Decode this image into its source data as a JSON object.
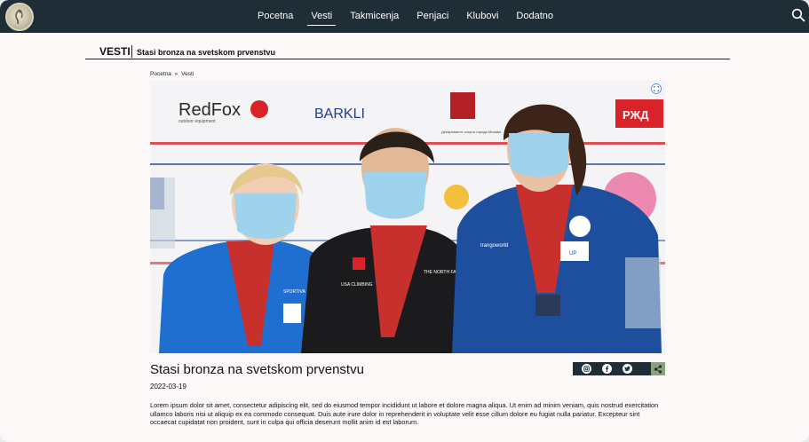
{
  "nav": {
    "items": [
      {
        "label": "Pocetna"
      },
      {
        "label": "Vesti"
      },
      {
        "label": "Takmicenja"
      },
      {
        "label": "Penjaci"
      },
      {
        "label": "Klubovi"
      },
      {
        "label": "Dodatno"
      }
    ],
    "active": "Vesti"
  },
  "section": {
    "title": "VESTI",
    "subtitle": "Stasi bronza na svetskom prvenstvu"
  },
  "breadcrumb": {
    "items": [
      "Pocetna",
      "»",
      "Vesti"
    ]
  },
  "photo": {
    "sponsors": [
      "RedFox",
      "outdoor equipment",
      "BARKLI",
      "Департамент спорта города Москвы",
      "РЖД"
    ],
    "jersey_labels": [
      "SPORTIVA",
      "USA CLIMBING",
      "THE NORTH FACE",
      "trangoworld",
      "UP"
    ]
  },
  "article": {
    "title": "Stasi bronza na svetskom prvenstvu",
    "date": "2022-03-19",
    "body": "Lorem ipsum dolor sit amet, consectetur adipiscing elit, sed do eiusmod tempor incididunt ut labore et dolore magna aliqua. Ut enim ad minim veniam, quis nostrud exercitation ullamco laboris nisi ut aliquip ex ea commodo consequat. Duis aute irure dolor in reprehenderit in voluptate velit esse cillum dolore eu fugiat nulla pariatur. Excepteur sint occaecat cupidatat non proident, sunt in culpa qui officia deserunt mollit anim id est laborum."
  },
  "share": {
    "icons": [
      "instagram-icon",
      "facebook-icon",
      "twitter-icon",
      "share-icon"
    ]
  },
  "colors": {
    "navbar": "#1f2d37",
    "page": "#fcf8f8",
    "share_accent": "#8aa37c"
  }
}
